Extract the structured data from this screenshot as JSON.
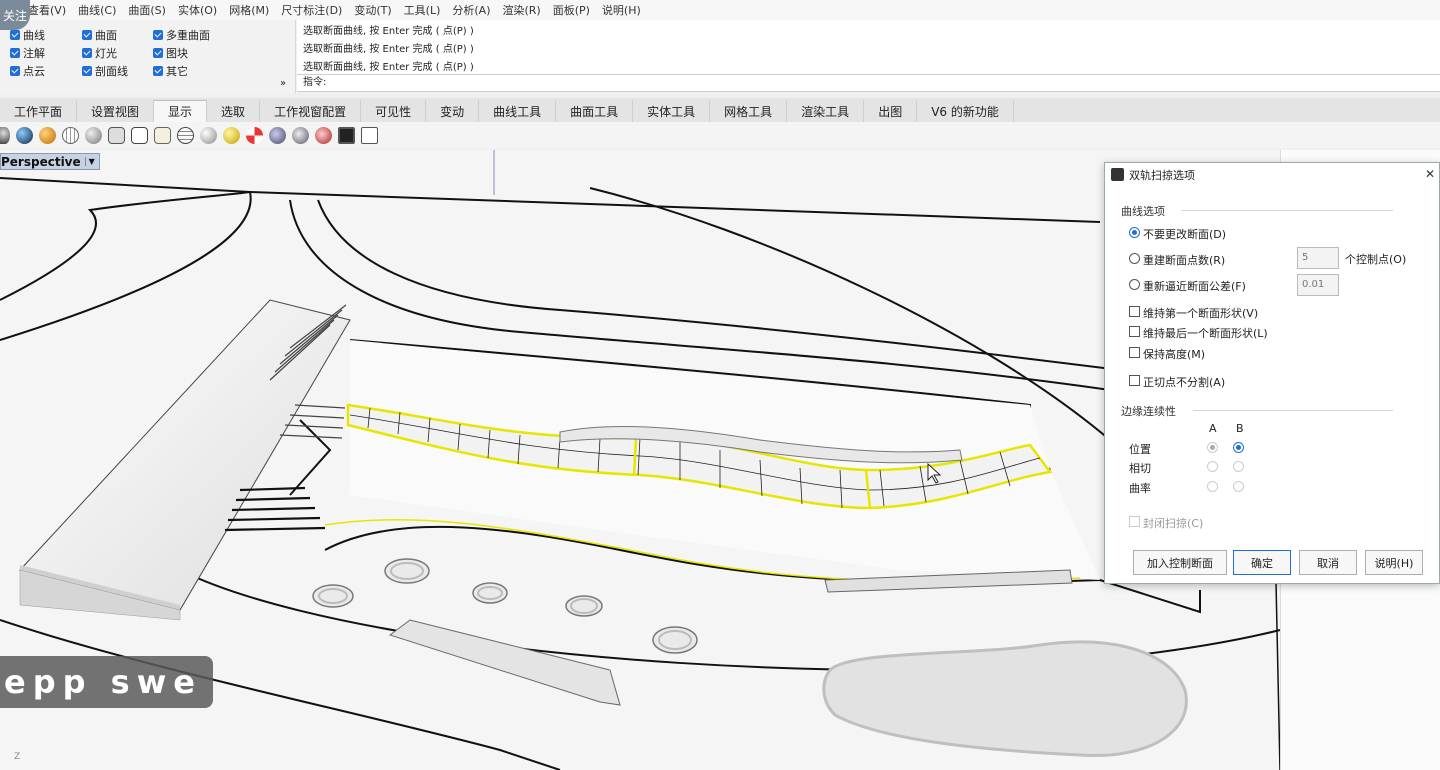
{
  "follow_badge": "关注",
  "menu": [
    "查看(V)",
    "曲线(C)",
    "曲面(S)",
    "实体(O)",
    "网格(M)",
    "尺寸标注(D)",
    "变动(T)",
    "工具(L)",
    "分析(A)",
    "渲染(R)",
    "面板(P)",
    "说明(H)"
  ],
  "filters": [
    {
      "label": "曲线"
    },
    {
      "label": "曲面"
    },
    {
      "label": "多重曲面"
    },
    {
      "label": "注解"
    },
    {
      "label": "灯光"
    },
    {
      "label": "图块"
    },
    {
      "label": "点云"
    },
    {
      "label": "剖面线"
    },
    {
      "label": "其它"
    }
  ],
  "filter_expand": "»",
  "command_history": [
    "选取断面曲线, 按 Enter 完成 ( 点(P) )",
    "选取断面曲线, 按 Enter 完成 ( 点(P) )",
    "选取断面曲线, 按 Enter 完成 ( 点(P) )"
  ],
  "command_prompt": "指令:",
  "tabs": [
    {
      "label": "工作平面"
    },
    {
      "label": "设置视图"
    },
    {
      "label": "显示",
      "active": true
    },
    {
      "label": "选取"
    },
    {
      "label": "工作视窗配置"
    },
    {
      "label": "可见性"
    },
    {
      "label": "变动"
    },
    {
      "label": "曲线工具"
    },
    {
      "label": "曲面工具"
    },
    {
      "label": "实体工具"
    },
    {
      "label": "网格工具"
    },
    {
      "label": "渲染工具"
    },
    {
      "label": "出图"
    },
    {
      "label": "V6 的新功能"
    }
  ],
  "toolbar_icons": [
    "shaded-sphere-icon",
    "rendered-sphere-icon",
    "gold-sphere-icon",
    "wireframe-sphere-icon",
    "ghosted-sphere-icon",
    "xray-cylinder-icon",
    "technical-cylinder-icon",
    "artistic-cylinder-icon",
    "pen-globe-icon",
    "gray-sphere-icon",
    "yellow-sphere-icon",
    "color-sphere-icon",
    "points-sphere-icon",
    "arrows-sphere-icon",
    "cross-sphere-icon",
    "monitor-icon",
    "cube-frame-icon"
  ],
  "viewport": {
    "label": "Perspective",
    "caption": "epp swe",
    "axis": "Z"
  },
  "dialog": {
    "title": "双轨扫掠选项",
    "curve_section": "曲线选项",
    "options": {
      "no_change": "不要更改断面(D)",
      "rebuild": "重建断面点数(R)",
      "refit": "重新逼近断面公差(F)"
    },
    "selected_option": "no_change",
    "rebuild_value": "5",
    "rebuild_unit": "个控制点(O)",
    "refit_value": "0.01",
    "checks": [
      "维持第一个断面形状(V)",
      "维持最后一个断面形状(L)",
      "保持高度(M)",
      "正切点不分割(A)"
    ],
    "edge_section": "边缘连续性",
    "col_a": "A",
    "col_b": "B",
    "rows": [
      "位置",
      "相切",
      "曲率"
    ],
    "closed_sweep": "封闭扫掠(C)",
    "buttons": {
      "add_section": "加入控制断面",
      "ok": "确定",
      "cancel": "取消",
      "help": "说明(H)"
    }
  }
}
